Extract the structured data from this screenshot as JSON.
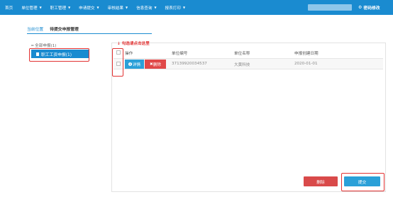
{
  "topnav": {
    "items": [
      {
        "label": "首页",
        "has_caret": false
      },
      {
        "label": "单位管理",
        "has_caret": true
      },
      {
        "label": "职工管理",
        "has_caret": true
      },
      {
        "label": "申请提交",
        "has_caret": true
      },
      {
        "label": "审核结果",
        "has_caret": true
      },
      {
        "label": "信息查询",
        "has_caret": true
      },
      {
        "label": "报表打印",
        "has_caret": true
      }
    ],
    "change_password": "密码修改",
    "gear_icon": "gear-icon",
    "color": "#1a8bd0"
  },
  "breadcrumb": {
    "current_label": "当前位置",
    "title": "待提交申报管理"
  },
  "tree": {
    "root_label": "全部申报(1)",
    "selected_label": "职工工资申报(1)"
  },
  "hint": {
    "text": "勾选请点击这里"
  },
  "table": {
    "headers": [
      "操作",
      "单位编号",
      "单位名称",
      "申报创建日期"
    ],
    "rows": [
      {
        "detail_label": "详情",
        "delete_label": "删除",
        "unit_no": "3713992003453​7",
        "unit_name": "大黄科技",
        "created_date": "2020-01-01"
      }
    ]
  },
  "footer": {
    "delete_label": "删除",
    "submit_label": "提交"
  },
  "colors": {
    "primary": "#1a8bd0",
    "danger": "#e04848",
    "annotation": "#e23232"
  }
}
